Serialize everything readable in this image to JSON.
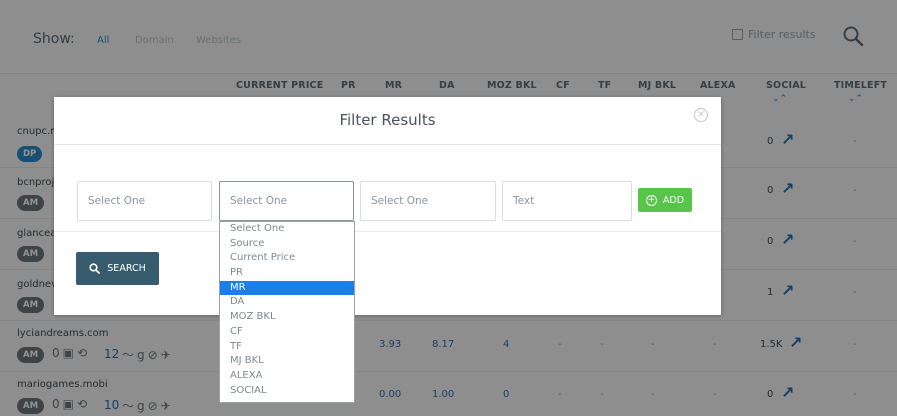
{
  "showbar": {
    "label": "Show:",
    "options": [
      "All",
      "Domain",
      "Websites"
    ],
    "filter_results": "Filter results"
  },
  "columns": [
    "CURRENT PRICE",
    "PR",
    "MR",
    "DA",
    "MOZ BKL",
    "CF",
    "TF",
    "MJ BKL",
    "ALEXA",
    "SOCIAL",
    "TIMELEFT"
  ],
  "rows": [
    {
      "site": "cnupc.n",
      "badge": "DP",
      "social": "0"
    },
    {
      "site": "bcnproj",
      "badge": "AM",
      "social": "0"
    },
    {
      "site": "glancea",
      "badge": "AM",
      "social": "0"
    },
    {
      "site": "goldnev",
      "badge": "AM",
      "social": "1"
    },
    {
      "site": "lyciandreams.com",
      "badge": "AM",
      "count": "12",
      "mr": "3.93",
      "da": "8.17",
      "mozbkl": "4",
      "social": "1.5K"
    },
    {
      "site": "mariogames.mobi",
      "badge": "AM",
      "count": "10",
      "mr": "0.00",
      "da": "1.00",
      "mozbkl": "0",
      "social": "0"
    }
  ],
  "dash": "-",
  "modal": {
    "title": "Filter Results",
    "field1_placeholder": "Select One",
    "field2_placeholder": "Select One",
    "field3_placeholder": "Select One",
    "text_placeholder": "Text",
    "add_label": "ADD",
    "search_label": "SEARCH"
  },
  "dropdown": {
    "options": [
      "Select One",
      "Source",
      "Current Price",
      "PR",
      "MR",
      "DA",
      "MOZ BKL",
      "CF",
      "TF",
      "MJ BKL",
      "ALEXA",
      "SOCIAL"
    ],
    "selected": "MR"
  },
  "colors": {
    "accent": "#2a8ac8",
    "add_green": "#56c54a",
    "search_btn": "#365c6e",
    "selected_option": "#1a7fe6"
  }
}
